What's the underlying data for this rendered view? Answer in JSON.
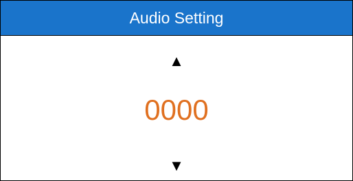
{
  "header": {
    "title": "Audio Setting"
  },
  "controls": {
    "up_arrow": "▲",
    "value": "0000",
    "down_arrow": "▼"
  },
  "colors": {
    "header_bg": "#1a74cb",
    "header_text": "#ffffff",
    "value_text": "#e07020",
    "border": "#000000"
  },
  "icons": {
    "up": "triangle-up-icon",
    "down": "triangle-down-icon"
  }
}
